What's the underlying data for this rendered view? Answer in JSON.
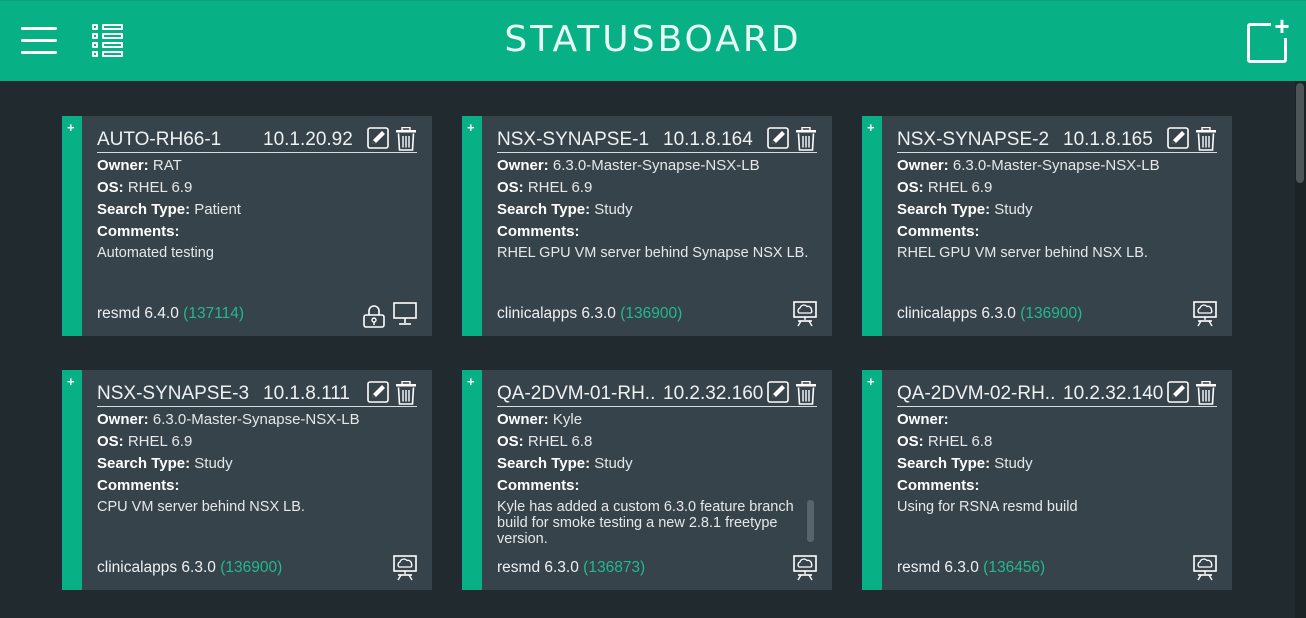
{
  "app": {
    "title": "STATUSBOARD"
  },
  "labels": {
    "owner": "Owner:",
    "os": "OS:",
    "search_type": "Search Type:",
    "comments": "Comments:"
  },
  "cards": [
    {
      "name": "AUTO-RH66-1",
      "ip": "10.1.20.92",
      "owner": "RAT",
      "os": "RHEL 6.9",
      "search_type": "Patient",
      "comments": "Automated testing",
      "product": "resmd 6.4.0",
      "build": "(137114)",
      "status_icons": [
        "lock-icon",
        "monitor-icon"
      ]
    },
    {
      "name": "NSX-SYNAPSE-1",
      "ip": "10.1.8.164",
      "owner": "6.3.0-Master-Synapse-NSX-LB",
      "os": "RHEL 6.9",
      "search_type": "Study",
      "comments": "RHEL GPU VM server behind Synapse NSX LB.",
      "product": "clinicalapps 6.3.0",
      "build": "(136900)",
      "status_icons": [
        "cloud-monitor-icon"
      ]
    },
    {
      "name": "NSX-SYNAPSE-2",
      "ip": "10.1.8.165",
      "owner": "6.3.0-Master-Synapse-NSX-LB",
      "os": "RHEL 6.9",
      "search_type": "Study",
      "comments": "RHEL GPU VM server behind NSX LB.",
      "product": "clinicalapps 6.3.0",
      "build": "(136900)",
      "status_icons": [
        "cloud-monitor-icon"
      ]
    },
    {
      "name": "NSX-SYNAPSE-3",
      "ip": "10.1.8.111",
      "owner": "6.3.0-Master-Synapse-NSX-LB",
      "os": "RHEL 6.9",
      "search_type": "Study",
      "comments": "CPU VM server behind NSX LB.",
      "product": "clinicalapps 6.3.0",
      "build": "(136900)",
      "status_icons": [
        "cloud-monitor-icon"
      ]
    },
    {
      "name": "QA-2DVM-01-RH...",
      "ip": "10.2.32.160",
      "owner": "Kyle",
      "os": "RHEL 6.8",
      "search_type": "Study",
      "comments": "Kyle has added a custom 6.3.0 feature branch build for smoke testing a new 2.8.1 freetype version.",
      "product": "resmd 6.3.0",
      "build": "(136873)",
      "status_icons": [
        "cloud-monitor-icon"
      ]
    },
    {
      "name": "QA-2DVM-02-RH...",
      "ip": "10.2.32.140",
      "owner": "",
      "os": "RHEL 6.8",
      "search_type": "Study",
      "comments": "Using for RSNA resmd build",
      "product": "resmd 6.3.0",
      "build": "(136456)",
      "status_icons": [
        "cloud-monitor-icon"
      ]
    }
  ],
  "colors": {
    "accent": "#08b086",
    "background": "#212a2e",
    "card": "#37434a",
    "build_number": "#21b98f"
  }
}
